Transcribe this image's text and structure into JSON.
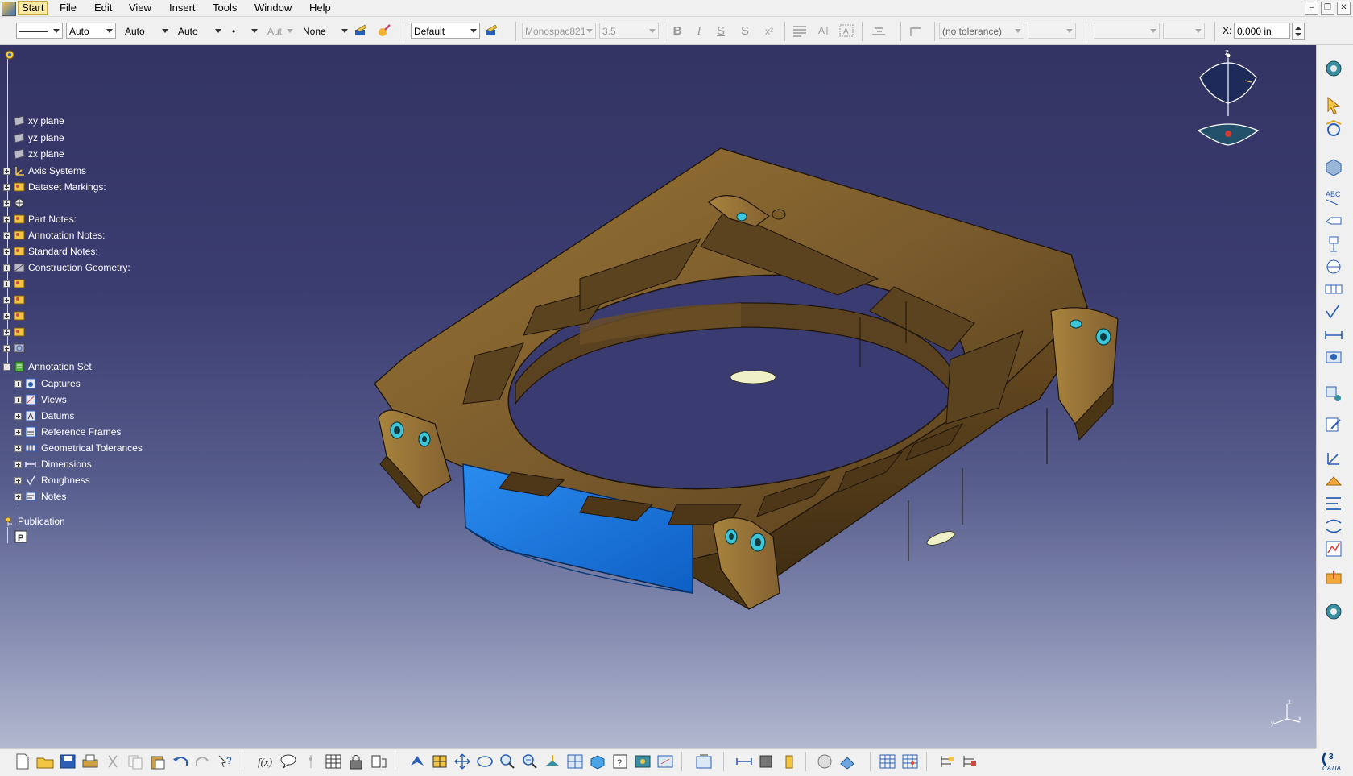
{
  "menubar": {
    "items": [
      "Start",
      "File",
      "Edit",
      "View",
      "Insert",
      "Tools",
      "Window",
      "Help"
    ]
  },
  "format_toolbar": {
    "line_combo": "",
    "color_combo": "Auto",
    "line_type_combo": "Auto",
    "thickness_combo": "Auto",
    "point_combo": "•",
    "layer_combo": "Aut",
    "fill_combo": "None",
    "style_combo": "Default",
    "font_combo": "Monospac821",
    "font_size_combo": "3.5",
    "bold": "B",
    "italic": "I",
    "underline": "S",
    "strike": "S",
    "superscript": "x²",
    "tolerance_combo": "(no tolerance)",
    "x_label": "X:",
    "x_value": "0.000 in"
  },
  "tree": {
    "nodes": [
      {
        "label": "xy plane"
      },
      {
        "label": "yz plane"
      },
      {
        "label": "zx plane"
      },
      {
        "label": "Axis Systems"
      },
      {
        "label": "Dataset Markings:"
      },
      {
        "label": ""
      },
      {
        "label": "Part Notes:"
      },
      {
        "label": "Annotation Notes:"
      },
      {
        "label": "Standard Notes:"
      },
      {
        "label": "Construction Geometry:"
      },
      {
        "label": ""
      },
      {
        "label": ""
      },
      {
        "label": ""
      },
      {
        "label": ""
      },
      {
        "label": ""
      },
      {
        "label": "Annotation Set."
      },
      {
        "label": "Captures"
      },
      {
        "label": "Views"
      },
      {
        "label": "Datums"
      },
      {
        "label": "Reference Frames"
      },
      {
        "label": "Geometrical Tolerances"
      },
      {
        "label": "Dimensions"
      },
      {
        "label": "Roughness"
      },
      {
        "label": "Notes"
      },
      {
        "label": "Publication"
      },
      {
        "label": ""
      }
    ]
  },
  "compass": {
    "axis_label": "z"
  },
  "colors": {
    "part": "#7a5b2c",
    "highlight": "#1e6fd9",
    "background_top": "#333463",
    "background_bottom": "#b2b8cf"
  }
}
